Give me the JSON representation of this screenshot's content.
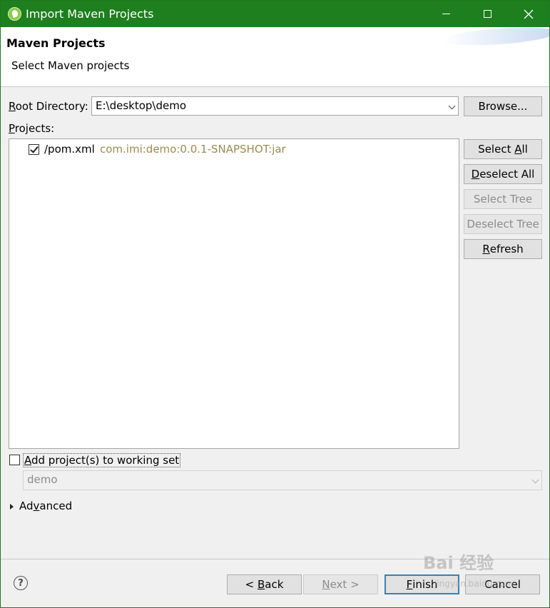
{
  "window": {
    "title": "Import Maven Projects",
    "title_bar_color": "#1e7f1e"
  },
  "header": {
    "title": "Maven Projects",
    "description": "Select Maven projects"
  },
  "root_directory": {
    "label_underlined": "R",
    "label_rest": "oot Directory:",
    "value": "E:\\desktop\\demo",
    "browse_label": "Browse..."
  },
  "projects": {
    "label_underlined": "P",
    "label_rest": "rojects:",
    "items": [
      {
        "name": "/pom.xml",
        "coordinates": "com.imi:demo:0.0.1-SNAPSHOT:jar",
        "checked": true
      }
    ],
    "coordinates_color": "#9c8b50"
  },
  "side_buttons": {
    "select_all_pre": "Select ",
    "select_all_u": "A",
    "select_all_post": "ll",
    "deselect_all_u": "D",
    "deselect_all_post": "eselect All",
    "select_tree": "Select Tree",
    "deselect_tree": "Deselect Tree",
    "refresh_u": "R",
    "refresh_post": "efresh"
  },
  "working_set": {
    "checkbox_u": "A",
    "checkbox_post": "dd project(s) to working set",
    "checked": false,
    "value": "demo"
  },
  "advanced": {
    "pre": "Ad",
    "u": "v",
    "post": "anced"
  },
  "footer": {
    "help_symbol": "?",
    "back_pre": "< ",
    "back_u": "B",
    "back_post": "ack",
    "next_u": "N",
    "next_post": "ext >",
    "finish_u": "F",
    "finish_post": "inish",
    "cancel": "Cancel"
  },
  "watermark": {
    "text": "Bai 经验",
    "sub": "jingyan.baidu.com"
  }
}
